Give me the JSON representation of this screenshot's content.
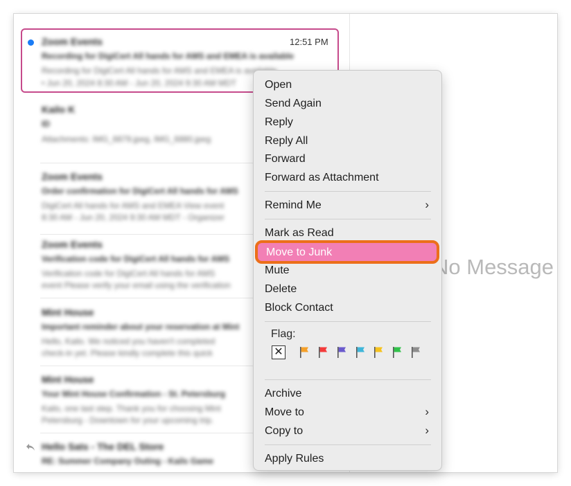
{
  "message_list": {
    "selected_message": {
      "sender": "Zoom Events",
      "time": "12:51 PM",
      "subject": "Recording for DigiCert All hands for AMS and EMEA is available",
      "preview_line1": "Recording for DigiCert All hands for AMS and EMEA is available",
      "preview_line2": "• Jun 20, 2024 8:30 AM - Jun 20, 2024 9:30 AM MDT"
    },
    "messages": [
      {
        "sender": "Kailo K",
        "subject": "ID",
        "preview_line1": "Attachments: IMG_6879.jpeg, IMG_6880.jpeg",
        "preview_line2": ""
      },
      {
        "sender": "Zoom Events",
        "subject": "Order confirmation for DigiCert All hands for AMS",
        "preview_line1": "DigiCert All hands for AMS and EMEA View event",
        "preview_line2": "8:30 AM - Jun 20, 2024 9:30 AM MDT - Organizer"
      },
      {
        "sender": "Zoom Events",
        "subject": "Verification code for DigiCert All hands for AMS",
        "preview_line1": "Verification code for DigiCert All hands for AMS",
        "preview_line2": "event Please verify your email using the verification"
      },
      {
        "sender": "Mint House",
        "subject": "Important reminder about your reservation at Mint",
        "preview_line1": "Hello, Kailo. We noticed you haven't completed",
        "preview_line2": "check-in yet. Please kindly complete this quick"
      },
      {
        "sender": "Mint House",
        "subject": "Your Mint House Confirmation - St. Petersburg",
        "preview_line1": "Kailo, one last step. Thank you for choosing Mint",
        "preview_line2": "Petersburg - Downtown for your upcoming trip."
      },
      {
        "sender": "Hello Sats - The DEL Store",
        "subject": "RE: Summer Company Outing - Kails Game",
        "preview_line1": "",
        "preview_line2": ""
      }
    ]
  },
  "preview_pane": {
    "empty_text": "No Message Selected"
  },
  "context_menu": {
    "open": "Open",
    "send_again": "Send Again",
    "reply": "Reply",
    "reply_all": "Reply All",
    "forward": "Forward",
    "forward_as_attachment": "Forward as Attachment",
    "remind_me": "Remind Me",
    "mark_as_read": "Mark as Read",
    "move_to_junk": "Move to Junk",
    "mute": "Mute",
    "delete": "Delete",
    "block_contact": "Block Contact",
    "flag_label": "Flag:",
    "flag_none_symbol": "✕",
    "archive": "Archive",
    "move_to": "Move to",
    "copy_to": "Copy to",
    "apply_rules": "Apply Rules",
    "submenu_chevron": "›",
    "highlighted_item": "Move to Junk"
  },
  "flag_colors": {
    "orange": "#f5a02a",
    "red": "#f43b3b",
    "purple": "#6a5acd",
    "teal": "#3fb6d9",
    "yellow": "#f6c21d",
    "green": "#31c24a",
    "gray": "#8e8e8e"
  },
  "colors": {
    "selection_border": "#c64a8b",
    "unread_dot": "#1a7cf5",
    "highlight_fill": "#f27fb5",
    "highlight_ring": "#ec6f1a"
  }
}
